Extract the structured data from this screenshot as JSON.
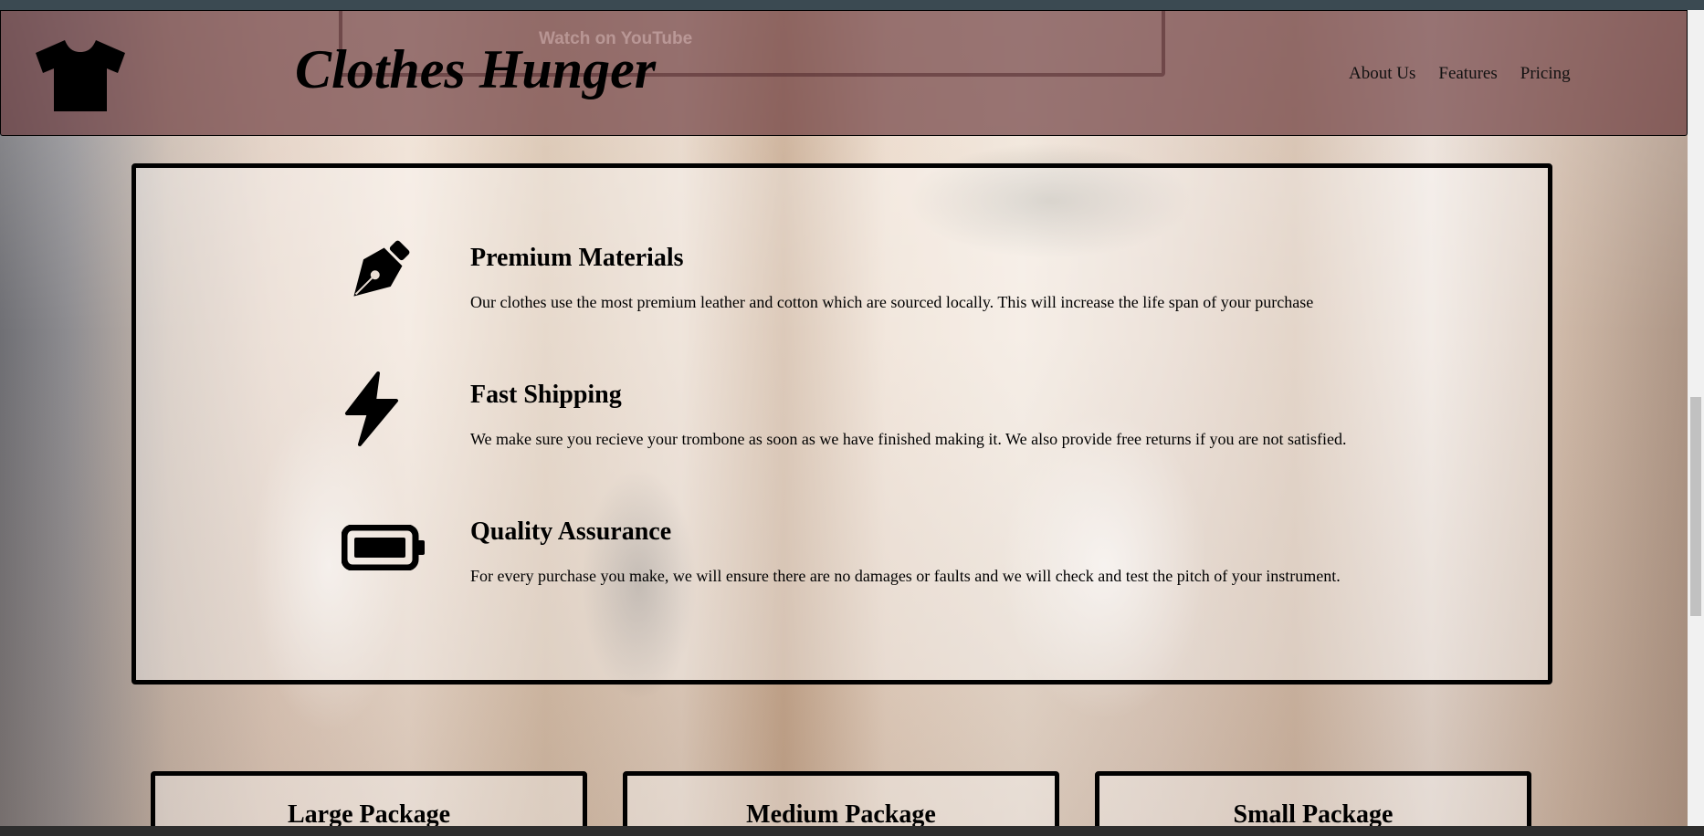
{
  "header": {
    "brand": "Clothes Hunger",
    "logo_icon": "tshirt-icon",
    "video_overlay_text": "Watch on  YouTube",
    "nav": [
      {
        "label": "About Us"
      },
      {
        "label": "Features"
      },
      {
        "label": "Pricing"
      }
    ]
  },
  "features": [
    {
      "icon": "pen-nib-icon",
      "title": "Premium Materials",
      "text": "Our clothes use the most premium leather and cotton which are sourced locally. This will increase the life span of your purchase"
    },
    {
      "icon": "bolt-icon",
      "title": "Fast Shipping",
      "text": "We make sure you recieve your trombone as soon as we have finished making it. We also provide free returns if you are not satisfied."
    },
    {
      "icon": "battery-full-icon",
      "title": "Quality Assurance",
      "text": "For every purchase you make, we will ensure there are no damages or faults and we will check and test the pitch of your instrument."
    }
  ],
  "pricing": [
    {
      "title": "Large Package"
    },
    {
      "title": "Medium Package"
    },
    {
      "title": "Small Package"
    }
  ],
  "colors": {
    "header_bg": "#69373a",
    "border": "#000000"
  }
}
